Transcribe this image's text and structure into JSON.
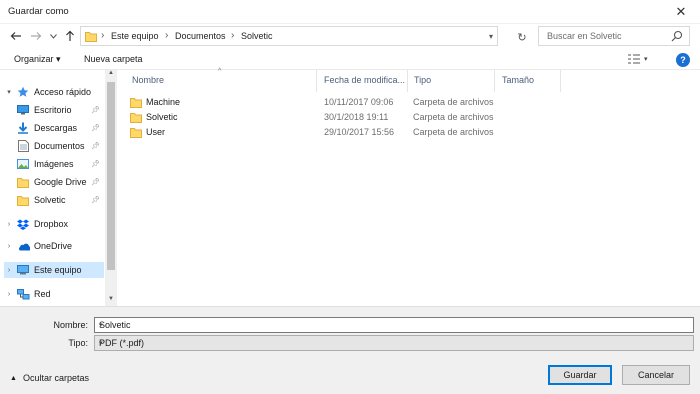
{
  "window": {
    "title": "Guardar como",
    "close_glyph": "✕"
  },
  "nav": {
    "breadcrumb": [
      "Este equipo",
      "Documentos",
      "Solvetic"
    ],
    "search_placeholder": "Buscar en Solvetic"
  },
  "toolbar": {
    "organize_label": "Organizar ▾",
    "new_folder_label": "Nueva carpeta",
    "help_glyph": "?"
  },
  "sidebar": {
    "items": [
      {
        "label": "Acceso rápido",
        "icon": "star-icon"
      },
      {
        "label": "Escritorio",
        "icon": "desktop-icon"
      },
      {
        "label": "Descargas",
        "icon": "download-icon"
      },
      {
        "label": "Documentos",
        "icon": "documents-icon"
      },
      {
        "label": "Imágenes",
        "icon": "pictures-icon"
      },
      {
        "label": "Google Drive",
        "icon": "folder-icon"
      },
      {
        "label": "Solvetic",
        "icon": "folder-icon"
      },
      {
        "label": "Dropbox",
        "icon": "dropbox-icon"
      },
      {
        "label": "OneDrive",
        "icon": "onedrive-icon"
      },
      {
        "label": "Este equipo",
        "icon": "computer-icon"
      },
      {
        "label": "Red",
        "icon": "network-icon"
      }
    ]
  },
  "files": {
    "columns": [
      "Nombre",
      "Fecha de modifica...",
      "Tipo",
      "Tamaño"
    ],
    "rows": [
      {
        "name": "Machine",
        "date": "10/11/2017 09:06",
        "type": "Carpeta de archivos"
      },
      {
        "name": "Solvetic",
        "date": "30/1/2018 19:11",
        "type": "Carpeta de archivos"
      },
      {
        "name": "User",
        "date": "29/10/2017 15:56",
        "type": "Carpeta de archivos"
      }
    ]
  },
  "bottom": {
    "name_label": "Nombre:",
    "name_value": "Solvetic",
    "type_label": "Tipo:",
    "type_value": "PDF (*.pdf)",
    "hide_folders_label": "Ocultar carpetas",
    "save_label": "Guardar",
    "cancel_label": "Cancelar"
  }
}
